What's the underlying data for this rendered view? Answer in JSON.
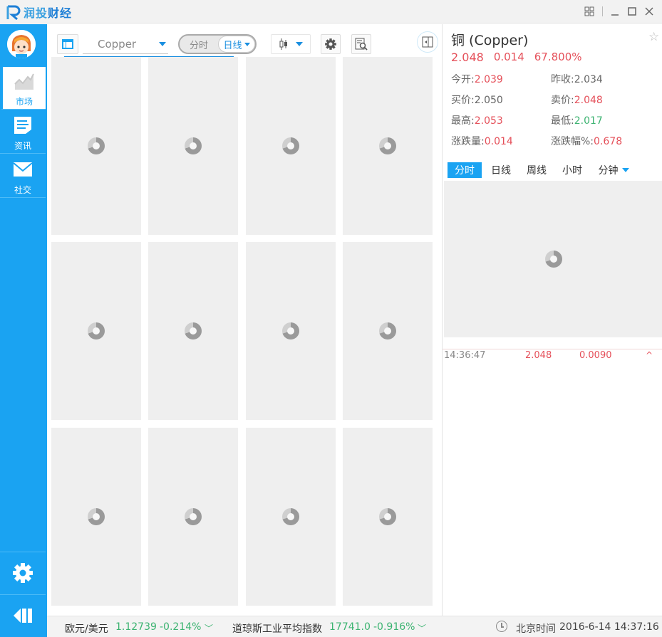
{
  "app": {
    "logo_part1": "润投",
    "logo_part2": "财经"
  },
  "sidebar": {
    "items": [
      {
        "label": "市场",
        "icon": "chart-trend-icon",
        "active": true
      },
      {
        "label": "资讯",
        "icon": "document-icon",
        "active": false
      },
      {
        "label": "社交",
        "icon": "mail-icon",
        "active": false
      }
    ],
    "bottom": [
      {
        "icon": "gear-icon"
      },
      {
        "icon": "collapse-left-icon"
      }
    ]
  },
  "toolbar": {
    "symbol": "Copper",
    "period_off": "分时",
    "period_on": "日线"
  },
  "grid": {
    "rows": 3,
    "cols": 4,
    "state": "loading"
  },
  "detail": {
    "title": "铜 (Copper)",
    "price": "2.048",
    "change": "0.014",
    "change_pct": "67.800%",
    "fields": [
      {
        "label": "今开:",
        "value": "2.039",
        "tone": "red"
      },
      {
        "label": "昨收:",
        "value": "2.034",
        "tone": "gray"
      },
      {
        "label": "买价:",
        "value": "2.050",
        "tone": "gray"
      },
      {
        "label": "卖价:",
        "value": "2.048",
        "tone": "red"
      },
      {
        "label": "最高:",
        "value": "2.053",
        "tone": "red"
      },
      {
        "label": "最低:",
        "value": "2.017",
        "tone": "green"
      },
      {
        "label": "涨跌量:",
        "value": "0.014",
        "tone": "red"
      },
      {
        "label": "涨跌幅%:",
        "value": "0.678",
        "tone": "red"
      }
    ],
    "tabs": [
      "分时",
      "日线",
      "周线",
      "小时",
      "分钟"
    ],
    "active_tab": "分时",
    "tick": {
      "time": "14:36:47",
      "price": "2.048",
      "change": "0.0090",
      "arrow": "^"
    }
  },
  "ticker": {
    "items": [
      {
        "name": "欧元/美元",
        "value": "1.12739",
        "change": "-0.214%"
      },
      {
        "name": "道琼斯工业平均指数",
        "value": "17741.0",
        "change": "-0.916%"
      }
    ],
    "clock_label": "北京时间",
    "datetime": "2016-6-14 14:37:16"
  },
  "colors": {
    "brand": "#1aa3f2",
    "up": "#e5505a",
    "down": "#3cb371"
  }
}
